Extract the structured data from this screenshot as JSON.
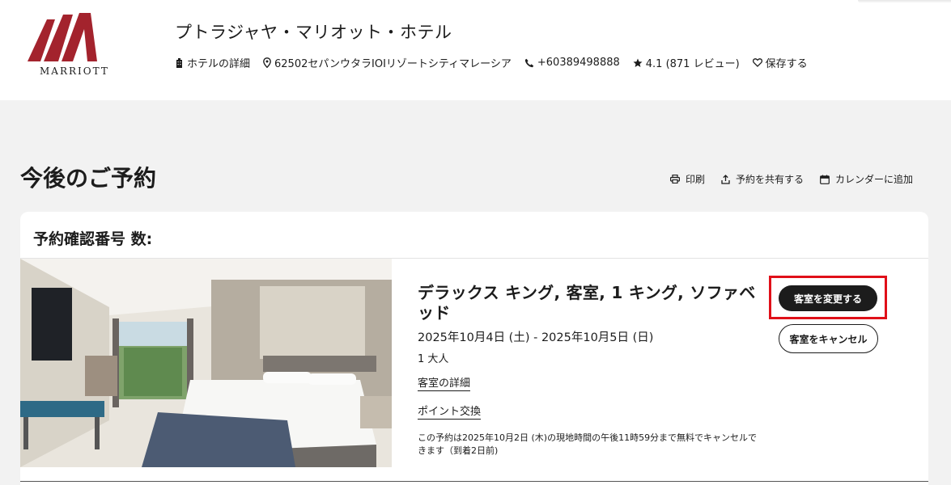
{
  "brand": {
    "name": "MARRIOTT",
    "accent": "#a3232d"
  },
  "hotel": {
    "name": "プトラジャヤ・マリオット・ホテル",
    "details_label": "ホテルの詳細",
    "address": "62502セパンウタラIOIリゾートシティマレーシア",
    "phone": "+60389498888",
    "rating": "4.1 (871 レビュー)",
    "save_label": "保存する"
  },
  "page": {
    "title": "今後のご予約",
    "actions": {
      "print": "印刷",
      "share": "予約を共有する",
      "calendar": "カレンダーに追加"
    }
  },
  "reservation": {
    "confirmation_label": "予約確認番号 数:",
    "room_title": "デラックス キング, 客室, 1 キング, ソファベッド",
    "dates": "2025年10月4日 (土) - 2025年10月5日 (日)",
    "guests": "1 大人",
    "room_details_link": "客室の詳細",
    "points_link": "ポイント交換",
    "cancel_note": "この予約は2025年10月2日 (木)の現地時間の午後11時59分まで無料でキャンセルできます（到着2日前)",
    "change_button": "客室を変更する",
    "cancel_button": "客室をキャンセル",
    "highlight_color": "#e01019"
  }
}
